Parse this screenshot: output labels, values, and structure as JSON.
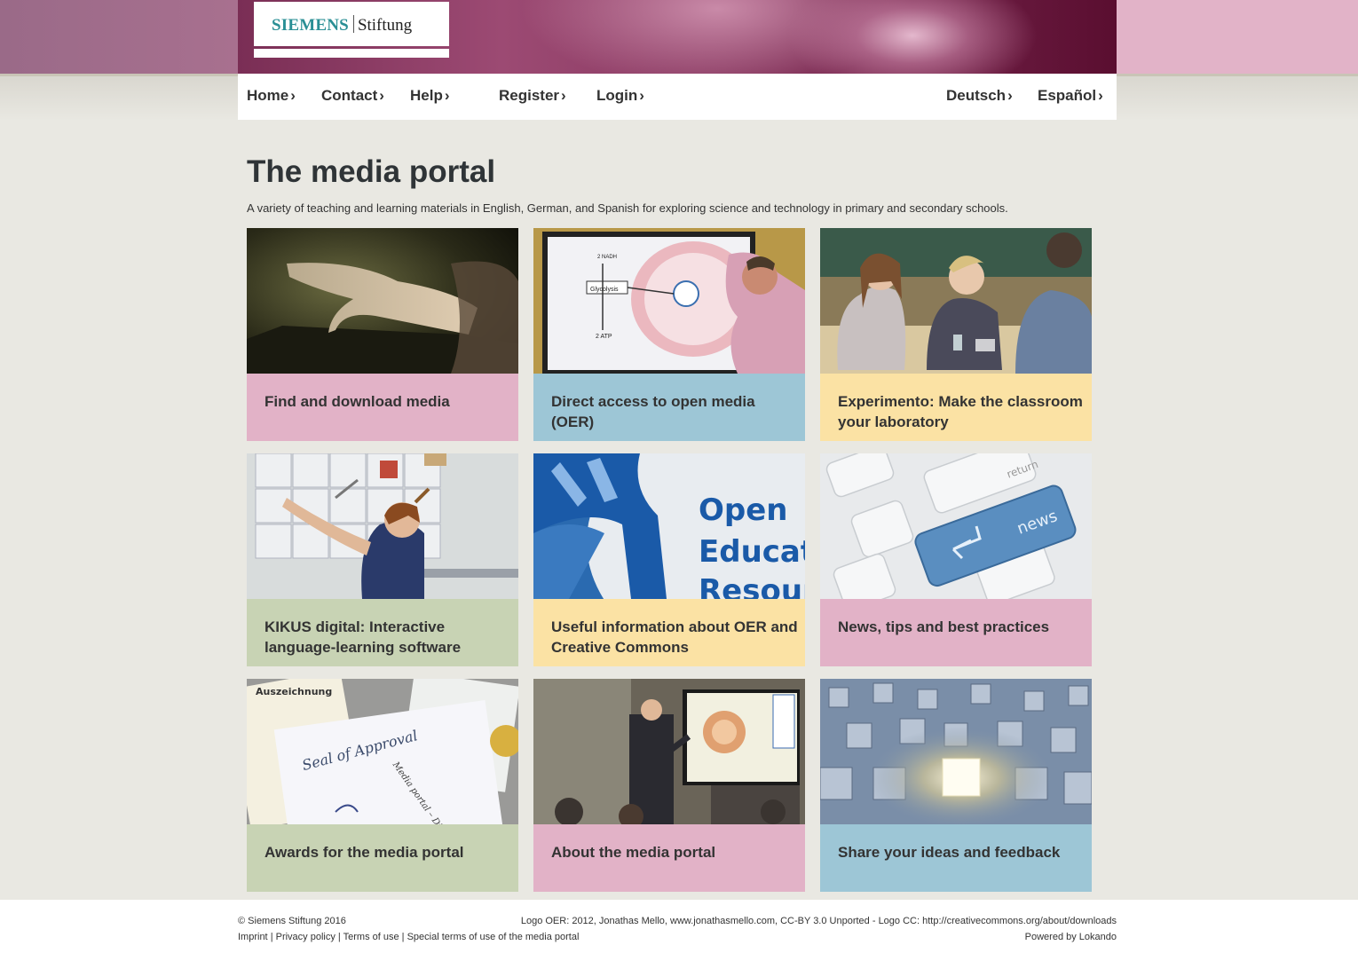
{
  "brand": {
    "company": "SIEMENS",
    "name": "Stiftung"
  },
  "nav": {
    "left": [
      {
        "label": "Home"
      },
      {
        "label": "Contact"
      },
      {
        "label": "Help"
      },
      {
        "label": "Register"
      },
      {
        "label": "Login"
      }
    ],
    "right": [
      {
        "label": "Deutsch"
      },
      {
        "label": "Español"
      }
    ],
    "chevron": "›"
  },
  "main": {
    "title": "The media portal",
    "subtitle": "A variety of teaching and learning materials in English, German, and Spanish for exploring science and technology in primary and secondary schools.",
    "tiles": [
      {
        "caption": "Find and download media",
        "color": "#e2b2c7",
        "image": "hand-touching-tablet"
      },
      {
        "caption": "Direct access to open media (OER)",
        "color": "#9dc6d6",
        "image": "teacher-at-interactive-whiteboard"
      },
      {
        "caption": "Experimento: Make the classroom your laboratory",
        "color": "#fbe2a4",
        "image": "students-doing-experiments"
      },
      {
        "caption": "KIKUS digital: Interactive language-learning software",
        "color": "#c8d3b4",
        "image": "child-at-smartboard"
      },
      {
        "caption": "Useful information about OER and Creative Commons",
        "color": "#fbe2a4",
        "image": "open-education-resources-logo"
      },
      {
        "caption": "News, tips and best practices",
        "color": "#e2b2c7",
        "image": "keyboard-news-key"
      },
      {
        "caption": "Awards for the media portal",
        "color": "#c8d3b4",
        "image": "award-certificates"
      },
      {
        "caption": "About the media portal",
        "color": "#e2b2c7",
        "image": "teacher-presenting-in-classroom"
      },
      {
        "caption": "Share your ideas and feedback",
        "color": "#9dc6d6",
        "image": "glowing-cube-among-cubes"
      }
    ],
    "image_text": {
      "oer_line1": "Open",
      "oer_line2": "Education",
      "oer_line3": "Resources",
      "news_key": "news",
      "return_key": "return",
      "seal": "Seal of Approval",
      "award_text": "Media portal – Digital teaching materials for teachers",
      "auszeichnung": "Auszeichnung",
      "glycolysis": "Glycolysis",
      "atp": "2 ATP",
      "nadh": "2 NADH"
    }
  },
  "footer": {
    "copyright": "© Siemens Stiftung 2016",
    "links": [
      "Imprint",
      "Privacy policy",
      "Terms of use",
      "Special terms of use of the media portal"
    ],
    "separator": "|",
    "credits": "Logo OER: 2012, Jonathas Mello, www.jonathasmello.com, CC-BY 3.0 Unported - Logo CC: http://creativecommons.org/about/downloads",
    "powered": "Powered by Lokando"
  }
}
